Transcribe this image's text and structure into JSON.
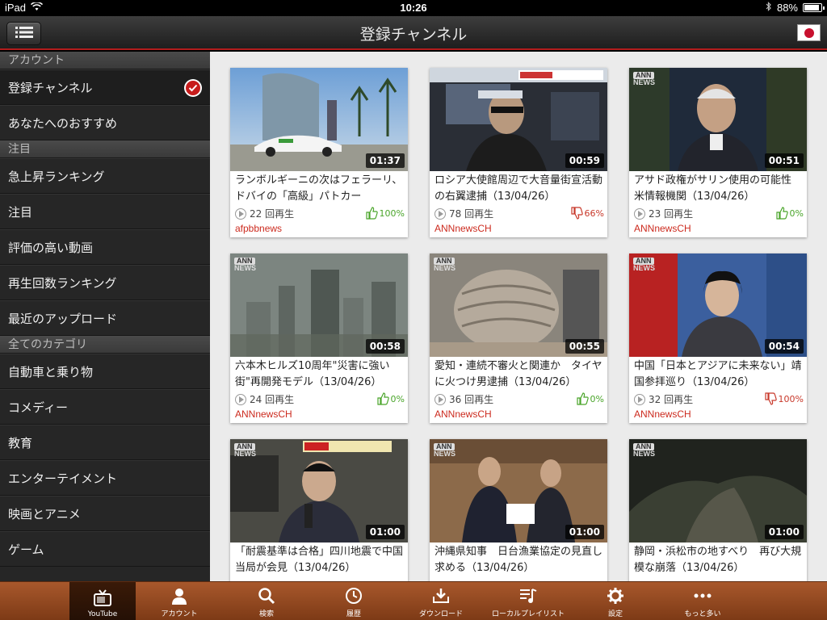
{
  "status": {
    "device": "iPad",
    "time": "10:26",
    "battery": "88%",
    "battery_level": 0.88
  },
  "header": {
    "title": "登録チャンネル"
  },
  "sidebar": {
    "sections": [
      {
        "header": "アカウント",
        "items": [
          {
            "label": "登録チャンネル",
            "selected": true
          },
          {
            "label": "あなたへのおすすめ"
          }
        ]
      },
      {
        "header": "注目",
        "items": [
          {
            "label": "急上昇ランキング"
          },
          {
            "label": "注目"
          },
          {
            "label": "評価の高い動画"
          },
          {
            "label": "再生回数ランキング"
          },
          {
            "label": "最近のアップロード"
          }
        ]
      },
      {
        "header": "全てのカテゴリ",
        "items": [
          {
            "label": "自動車と乗り物"
          },
          {
            "label": "コメディー"
          },
          {
            "label": "教育"
          },
          {
            "label": "エンターテイメント"
          },
          {
            "label": "映画とアニメ"
          },
          {
            "label": "ゲーム"
          }
        ]
      }
    ]
  },
  "videos": [
    {
      "duration": "01:37",
      "title": "ランボルギーニの次はフェラーリ、ドバイの「高級」パトカー",
      "views": "22 回再生",
      "rating": "100%",
      "rating_dir": "up",
      "channel": "afpbbnews"
    },
    {
      "duration": "00:59",
      "title": "ロシア大使館周辺で大音量街宣活動の右翼逮捕（13/04/26）",
      "views": "78 回再生",
      "rating": "66%",
      "rating_dir": "down",
      "channel": "ANNnewsCH"
    },
    {
      "duration": "00:51",
      "title": "アサド政権がサリン使用の可能性　米情報機関（13/04/26）",
      "views": "23 回再生",
      "rating": "0%",
      "rating_dir": "up",
      "channel": "ANNnewsCH"
    },
    {
      "duration": "00:58",
      "title": "六本木ヒルズ10周年\"災害に強い街\"再開発モデル（13/04/26）",
      "views": "24 回再生",
      "rating": "0%",
      "rating_dir": "up",
      "channel": "ANNnewsCH"
    },
    {
      "duration": "00:55",
      "title": "愛知・連続不審火と関連か　タイヤに火つけ男逮捕（13/04/26）",
      "views": "36 回再生",
      "rating": "0%",
      "rating_dir": "up",
      "channel": "ANNnewsCH"
    },
    {
      "duration": "00:54",
      "title": "中国「日本とアジアに未来ない」靖国参拝巡り（13/04/26）",
      "views": "32 回再生",
      "rating": "100%",
      "rating_dir": "down",
      "channel": "ANNnewsCH"
    },
    {
      "duration": "01:00",
      "title": "「耐震基準は合格」四川地震で中国当局が会見（13/04/26）",
      "views": "",
      "rating": "",
      "rating_dir": "up",
      "channel": ""
    },
    {
      "duration": "01:00",
      "title": "沖縄県知事　日台漁業協定の見直し求める（13/04/26）",
      "views": "",
      "rating": "",
      "rating_dir": "down",
      "channel": ""
    },
    {
      "duration": "01:00",
      "title": "静岡・浜松市の地すべり　再び大規模な崩落（13/04/26）",
      "views": "",
      "rating": "",
      "rating_dir": "up",
      "channel": ""
    }
  ],
  "thumb_badge": {
    "line1": "ANN",
    "line2": "NEWS"
  },
  "tabs": [
    {
      "label": "YouTube",
      "icon": "tv-icon",
      "active": true
    },
    {
      "label": "アカウント",
      "icon": "person-icon"
    },
    {
      "label": "検索",
      "icon": "search-icon"
    },
    {
      "label": "履歴",
      "icon": "clock-icon"
    },
    {
      "label": "ダウンロード",
      "icon": "download-icon"
    },
    {
      "label": "ローカルプレイリスト",
      "icon": "playlist-icon"
    },
    {
      "label": "設定",
      "icon": "gear-icon"
    },
    {
      "label": "もっと多い",
      "icon": "more-icon"
    }
  ],
  "colors": {
    "accent": "#c71c1c",
    "channel": "#cc2a1e",
    "tabbar": "#9a4a22",
    "like": "#4aa52a",
    "dislike": "#c8382a"
  }
}
